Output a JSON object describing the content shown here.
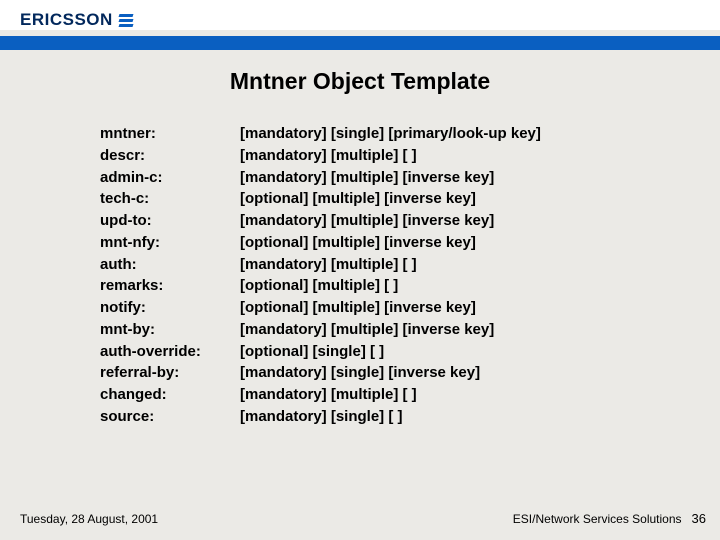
{
  "header": {
    "brand": "ERICSSON"
  },
  "title": "Mntner Object Template",
  "template": [
    {
      "name": "mntner:",
      "attr": "[mandatory] [single] [primary/look-up key]"
    },
    {
      "name": "descr:",
      "attr": "[mandatory] [multiple] [ ]"
    },
    {
      "name": "admin-c:",
      "attr": "[mandatory] [multiple] [inverse key]"
    },
    {
      "name": "tech-c:",
      "attr": "[optional] [multiple] [inverse key]"
    },
    {
      "name": "upd-to:",
      "attr": "[mandatory] [multiple] [inverse key]"
    },
    {
      "name": "mnt-nfy:",
      "attr": "[optional] [multiple] [inverse key]"
    },
    {
      "name": "auth:",
      "attr": "[mandatory] [multiple] [ ]"
    },
    {
      "name": "remarks:",
      "attr": "[optional] [multiple] [ ]"
    },
    {
      "name": "notify:",
      "attr": "[optional] [multiple] [inverse key]"
    },
    {
      "name": "mnt-by:",
      "attr": "[mandatory] [multiple] [inverse key]"
    },
    {
      "name": "auth-override:",
      "attr": "[optional] [single] [ ]"
    },
    {
      "name": "referral-by:",
      "attr": "[mandatory] [single] [inverse key]"
    },
    {
      "name": "changed:",
      "attr": "[mandatory] [multiple] [ ]"
    },
    {
      "name": "source:",
      "attr": "[mandatory] [single] [ ]"
    }
  ],
  "footer": {
    "date": "Tuesday, 28 August, 2001",
    "org": "ESI/Network Services Solutions",
    "page": "36"
  }
}
